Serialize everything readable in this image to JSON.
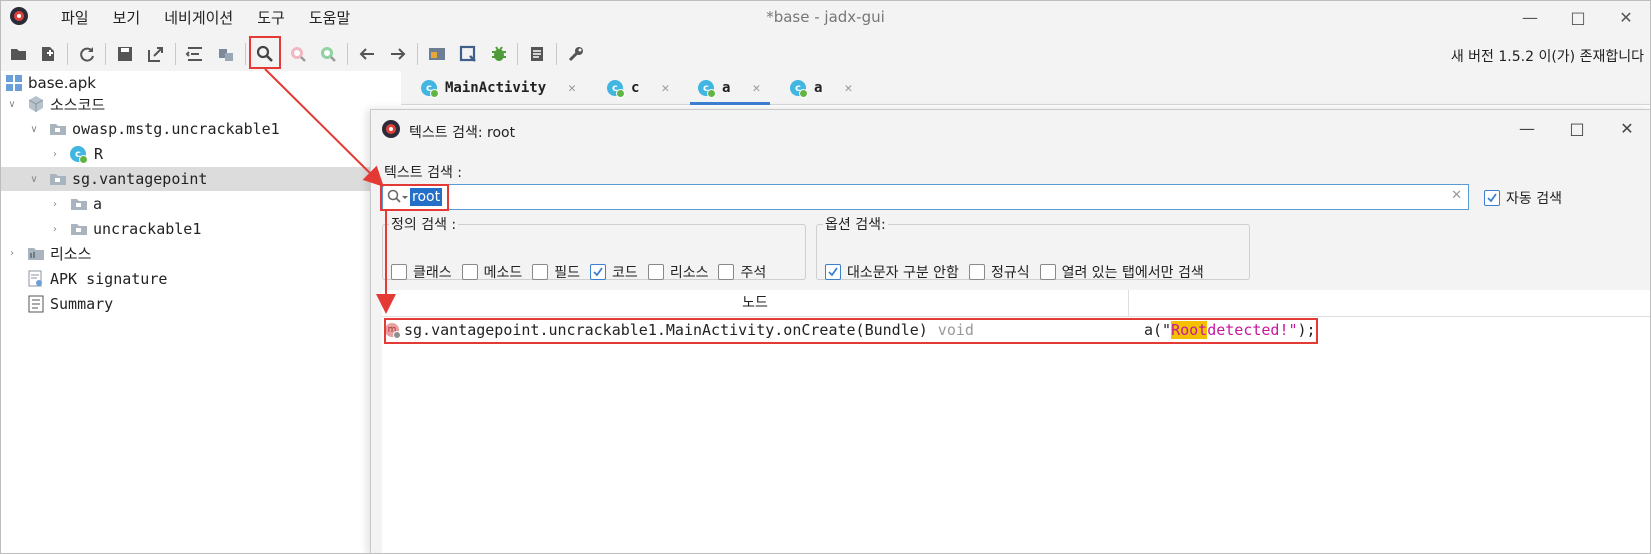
{
  "window": {
    "title": "*base - jadx-gui",
    "menu": [
      "파일",
      "보기",
      "네비게이션",
      "도구",
      "도움말"
    ],
    "minimize_icon": "minimize-icon",
    "maximize_icon": "maximize-icon",
    "close_icon": "close-icon"
  },
  "toolbar": {
    "icons": [
      "open-file-icon",
      "add-files-icon",
      "reload-icon",
      "save-icon",
      "export-icon",
      "sync-tree-icon",
      "flatten-packages-icon",
      "search-icon",
      "class-search-icon",
      "usage-search-icon",
      "back-icon",
      "forward-icon",
      "deobfuscation-icon",
      "quark-icon",
      "debug-icon",
      "log-icon",
      "preferences-icon"
    ],
    "update_notice": "새 버전 1.5.2 이(가) 존재합니다"
  },
  "tree": {
    "root": "base.apk",
    "source": "소스코드",
    "pkg1": "owasp.mstg.uncrackable1",
    "pkg1_class": "R",
    "pkg2": "sg.vantagepoint",
    "pkg2_sub1": "a",
    "pkg2_sub2": "uncrackable1",
    "resources": "리소스",
    "apk_signature": "APK signature",
    "summary": "Summary"
  },
  "tabs": [
    {
      "label": "MainActivity",
      "active": false
    },
    {
      "label": "c",
      "active": false
    },
    {
      "label": "a",
      "active": true
    },
    {
      "label": "a",
      "active": false
    }
  ],
  "dialog": {
    "title": "텍스트 검색: root",
    "search_label": "텍스트 검색 :",
    "search_value": "root",
    "auto_search_label": "자동 검색",
    "auto_search_checked": true,
    "definition_group": {
      "legend": "정의 검색 :",
      "options": [
        {
          "label": "클래스",
          "checked": false
        },
        {
          "label": "메소드",
          "checked": false
        },
        {
          "label": "필드",
          "checked": false
        },
        {
          "label": "코드",
          "checked": true
        },
        {
          "label": "리소스",
          "checked": false
        },
        {
          "label": "주석",
          "checked": false
        }
      ]
    },
    "options_group": {
      "legend": "옵션 검색:",
      "options": [
        {
          "label": "대소문자 구분 안함",
          "checked": true
        },
        {
          "label": "정규식",
          "checked": false
        },
        {
          "label": "열려 있는 탭에서만 검색",
          "checked": false
        }
      ]
    },
    "results": {
      "column_node": "노드",
      "column_code": "",
      "rows": [
        {
          "node": "sg.vantagepoint.uncrackable1.MainActivity.onCreate(Bundle)",
          "return_type": "void",
          "code_prefix": "a(\"",
          "code_match": "Root",
          "code_rest": " detected!\"",
          "code_suffix": ");"
        }
      ]
    }
  },
  "colors": {
    "annotation_red": "#e53935",
    "selection_blue": "#2470c9",
    "match_highlight": "#f4c000",
    "string_magenta": "#c6179f",
    "tab_active_underline": "#3d7fd1"
  }
}
